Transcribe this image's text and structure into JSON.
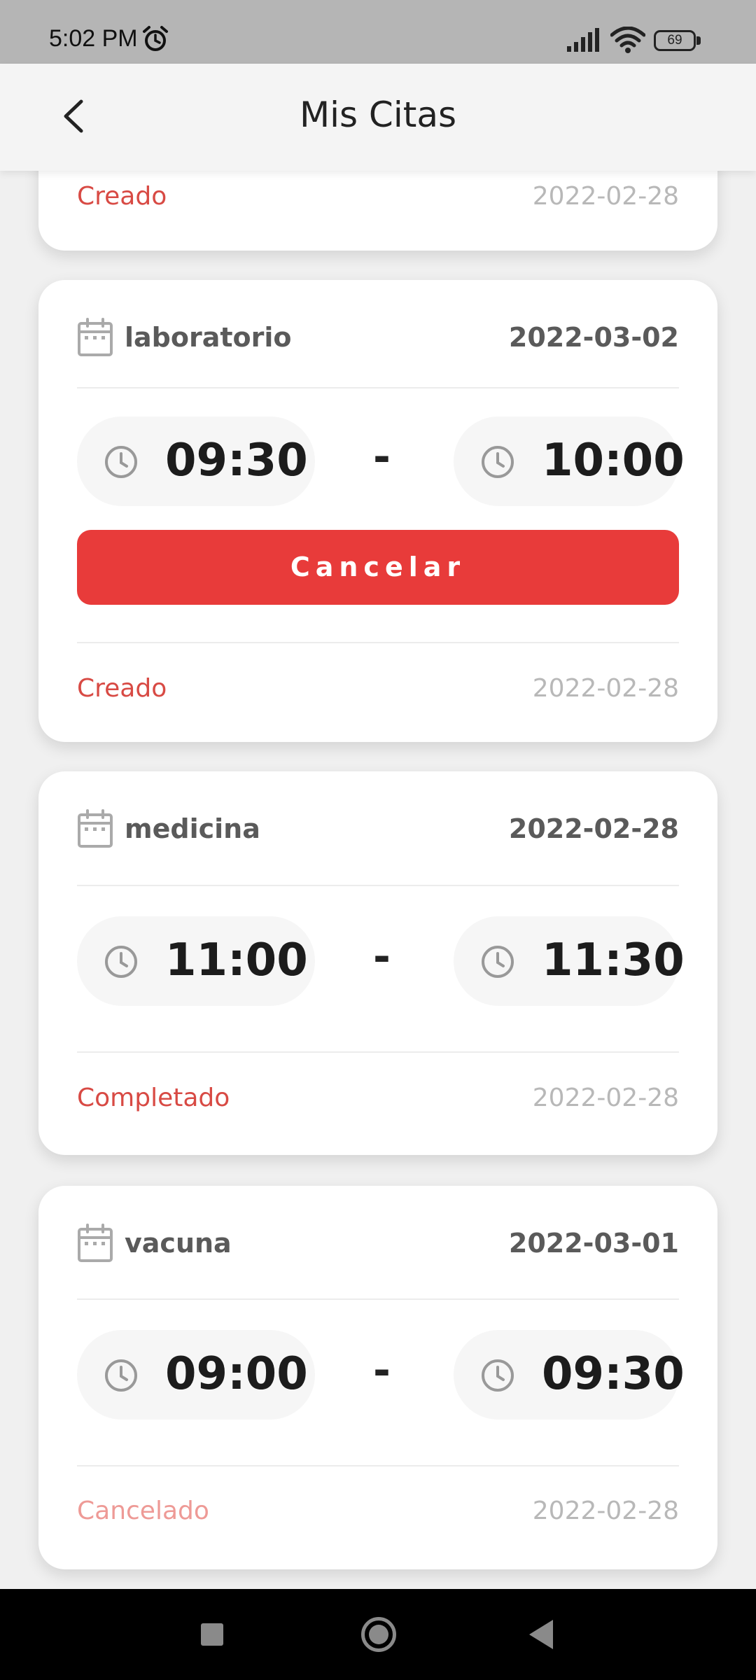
{
  "status_bar": {
    "time": "5:02 PM",
    "battery_level": "69"
  },
  "header": {
    "title": "Mis Citas"
  },
  "partial_card": {
    "status": "Creado",
    "created_date": "2022-02-28"
  },
  "appointments": [
    {
      "category": "laboratorio",
      "date": "2022-03-02",
      "start_time": "09:30",
      "separator": "-",
      "end_time": "10:00",
      "action_label": "Cancelar",
      "status": "Creado",
      "created_date": "2022-02-28"
    },
    {
      "category": "medicina",
      "date": "2022-02-28",
      "start_time": "11:00",
      "separator": "-",
      "end_time": "11:30",
      "status": "Completado",
      "created_date": "2022-02-28"
    },
    {
      "category": "vacuna",
      "date": "2022-03-01",
      "start_time": "09:00",
      "separator": "-",
      "end_time": "09:30",
      "status": "Cancelado",
      "created_date": "2022-02-28"
    }
  ],
  "colors": {
    "accent": "#e83b3a",
    "status_red": "#d84a44",
    "status_faded": "#ee9a96",
    "muted_text": "#b8b8b8"
  },
  "icons": [
    "alarm-icon",
    "signal-icon",
    "wifi-icon",
    "battery-icon",
    "back-arrow-icon",
    "calendar-icon",
    "clock-icon"
  ]
}
